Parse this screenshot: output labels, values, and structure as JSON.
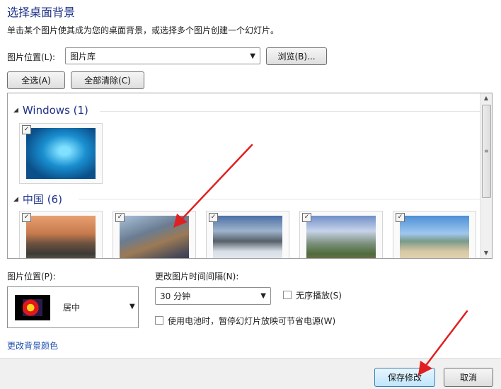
{
  "header": {
    "title": "选择桌面背景",
    "subtitle": "单击某个图片使其成为您的桌面背景，或选择多个图片创建一个幻灯片。"
  },
  "location": {
    "label": "图片位置(L):",
    "value": "图片库",
    "browse_label": "浏览(B)..."
  },
  "selection": {
    "select_all_label": "全选(A)",
    "clear_all_label": "全部清除(C)"
  },
  "gallery": {
    "groups": [
      {
        "name": "Windows (1)",
        "images": [
          {
            "icon": "windows-blue-wallpaper",
            "checked": true
          }
        ]
      },
      {
        "name": "中国 (6)",
        "images": [
          {
            "icon": "guilin-river-wallpaper",
            "checked": true
          },
          {
            "icon": "great-wall-wallpaper",
            "checked": true
          },
          {
            "icon": "huangshan-mountain-wallpaper",
            "checked": true
          },
          {
            "icon": "rice-terrace-wallpaper",
            "checked": true
          },
          {
            "icon": "beach-rocks-wallpaper",
            "checked": true
          }
        ]
      }
    ]
  },
  "position": {
    "label": "图片位置(P):",
    "value": "居中"
  },
  "interval": {
    "label": "更改图片时间间隔(N):",
    "value": "30 分钟"
  },
  "options": {
    "shuffle_label": "无序播放(S)",
    "battery_label": "使用电池时，暂停幻灯片放映可节省电源(W)"
  },
  "links": {
    "change_color": "更改背景颜色"
  },
  "footer": {
    "save_label": "保存修改",
    "cancel_label": "取消"
  },
  "colors": {
    "title": "#1e3287",
    "annotation_arrow": "#e02020"
  }
}
